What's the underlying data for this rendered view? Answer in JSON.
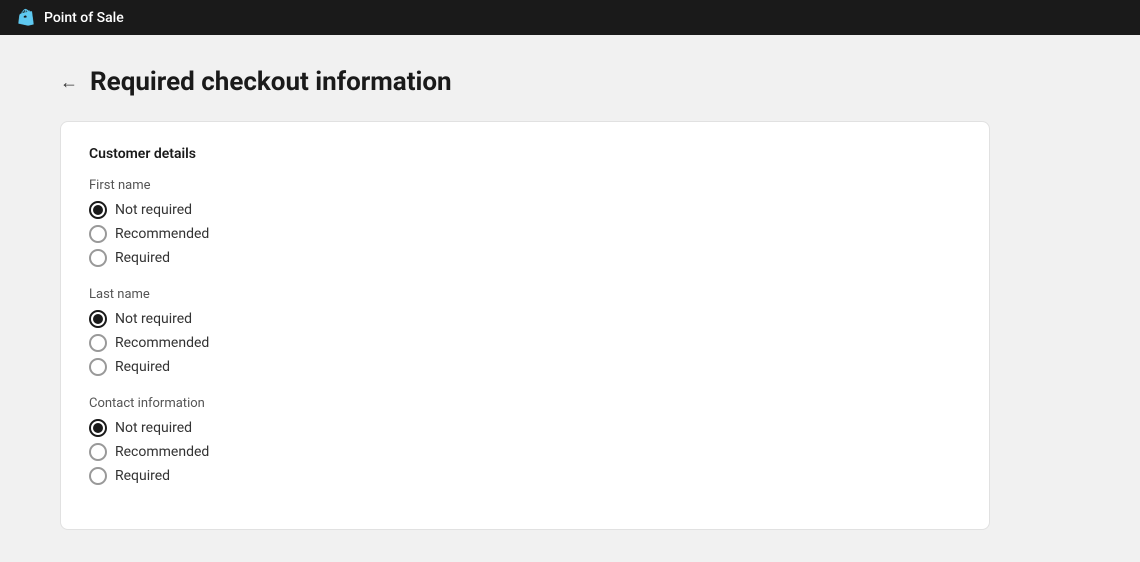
{
  "nav": {
    "title": "Point of Sale",
    "icon": "shopify-icon"
  },
  "page": {
    "back_label": "←",
    "title": "Required checkout information"
  },
  "card": {
    "section_title": "Customer details",
    "fields": [
      {
        "id": "first_name",
        "label": "First name",
        "options": [
          {
            "value": "not_required",
            "label": "Not required",
            "checked": true
          },
          {
            "value": "recommended",
            "label": "Recommended",
            "checked": false
          },
          {
            "value": "required",
            "label": "Required",
            "checked": false
          }
        ]
      },
      {
        "id": "last_name",
        "label": "Last name",
        "options": [
          {
            "value": "not_required",
            "label": "Not required",
            "checked": true
          },
          {
            "value": "recommended",
            "label": "Recommended",
            "checked": false
          },
          {
            "value": "required",
            "label": "Required",
            "checked": false
          }
        ]
      },
      {
        "id": "contact_information",
        "label": "Contact information",
        "options": [
          {
            "value": "not_required",
            "label": "Not required",
            "checked": true
          },
          {
            "value": "recommended",
            "label": "Recommended",
            "checked": false
          },
          {
            "value": "required",
            "label": "Required",
            "checked": false
          }
        ]
      }
    ]
  }
}
